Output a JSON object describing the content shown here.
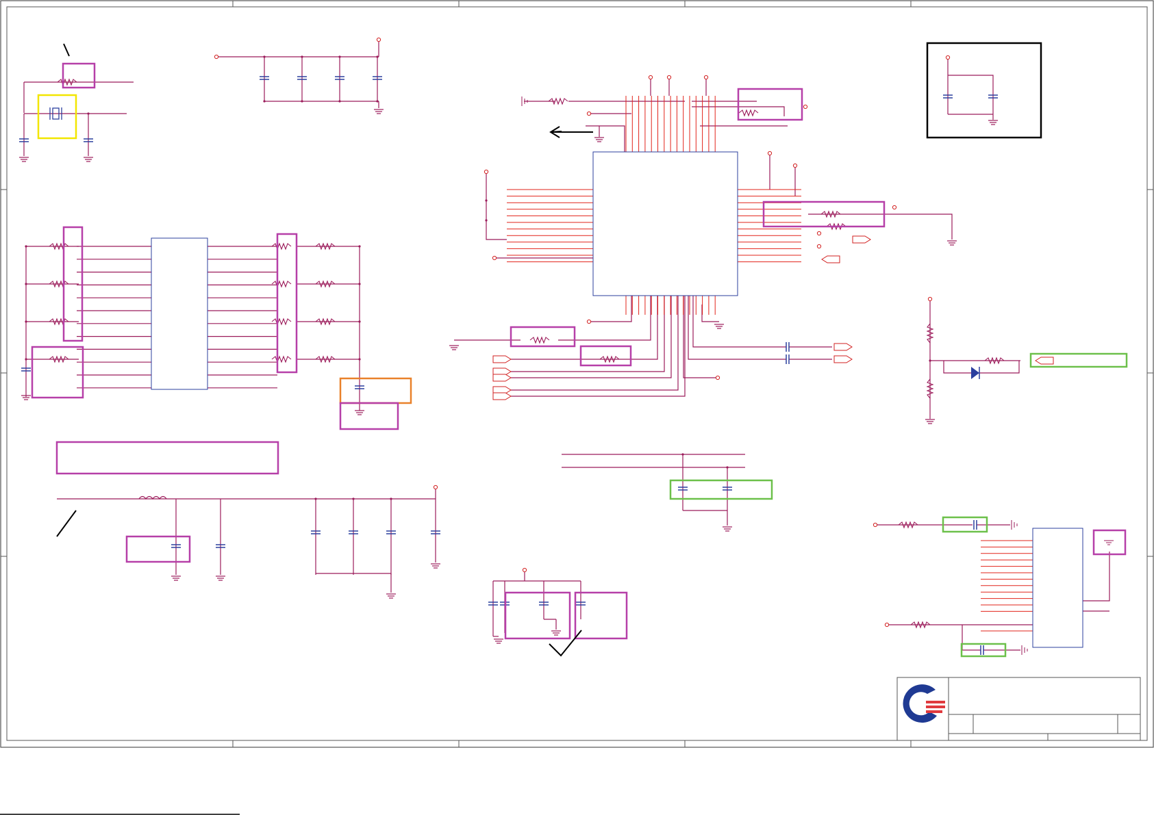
{
  "schematic": {
    "colors": {
      "background": "#ffffff",
      "border": "#555555",
      "wire": "#9b1b5a",
      "net": "#e2231a",
      "part": "#2b3f9e",
      "pin": "#d21f1f",
      "highlight_purple": "#b63fa8",
      "highlight_yellow": "#f2e600",
      "highlight_orange": "#e9812a",
      "highlight_green": "#6cc04a",
      "annotation": "#000000",
      "logo_blue": "#1f3a93",
      "logo_red": "#e03a3e"
    },
    "logo": {
      "icon": "company-logo-icon"
    }
  }
}
